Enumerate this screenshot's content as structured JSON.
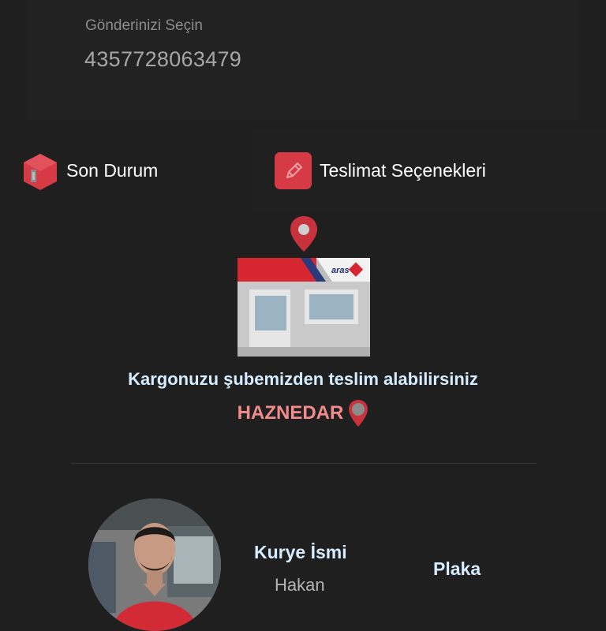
{
  "shipment": {
    "label": "Gönderinizi Seçin",
    "number": "4357728063479"
  },
  "tabs": [
    {
      "label": "Son Durum",
      "icon": "box-icon"
    },
    {
      "label": "Teslimat Seçenekleri",
      "icon": "pencil-icon"
    }
  ],
  "delivery_status": {
    "message": "Kargonuzu şubemizden teslim alabilirsiniz",
    "branch": "HAZNEDAR",
    "branch_sign": "aras"
  },
  "courier": {
    "title": "Kurye İsmi",
    "name": "Hakan",
    "plate_title": "Plaka"
  },
  "colors": {
    "background": "#1f1f1f",
    "accent_red": "#d63a44",
    "branch_text": "#f28b8b",
    "heading_text": "#d6ecff"
  }
}
